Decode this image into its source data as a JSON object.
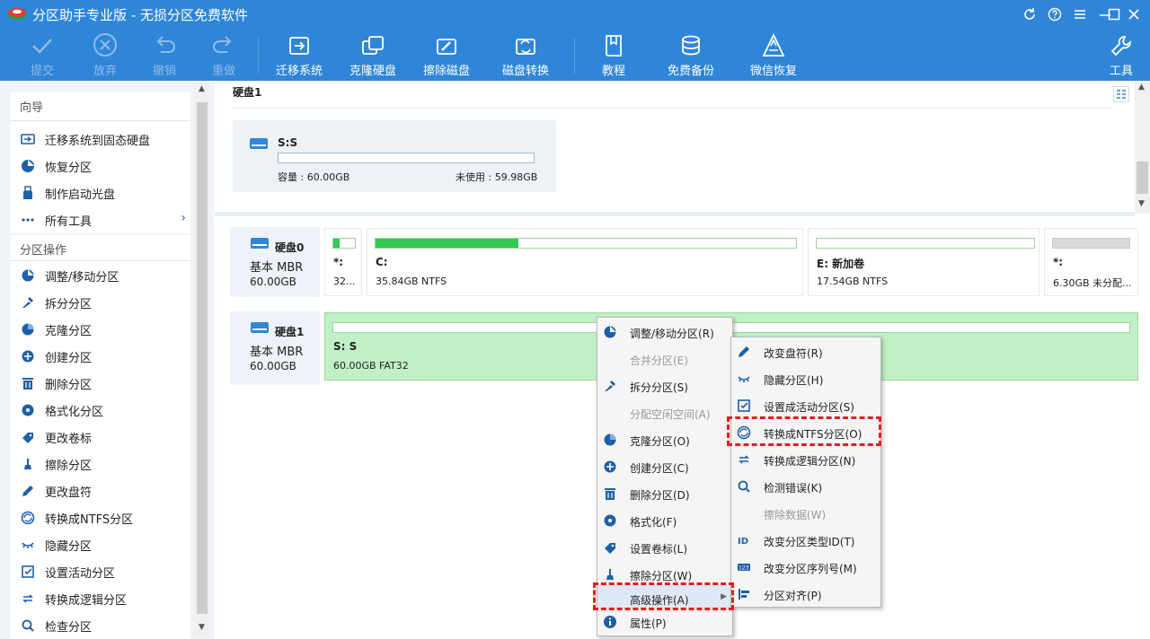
{
  "window": {
    "title": "分区助手专业版 - 无损分区免费软件"
  },
  "toolbar": {
    "commit": "提交",
    "discard": "放弃",
    "undo": "撤销",
    "redo": "重做",
    "migrate": "迁移系统",
    "clone": "克隆硬盘",
    "wipe": "擦除磁盘",
    "convert": "磁盘转换",
    "tutorial": "教程",
    "backup": "免费备份",
    "wechat": "微信恢复",
    "tools": "工具"
  },
  "sidebar": {
    "wizard_title": "向导",
    "wizard_items": [
      "迁移系统到固态硬盘",
      "恢复分区",
      "制作启动光盘",
      "所有工具"
    ],
    "ops_title": "分区操作",
    "ops_items": [
      "调整/移动分区",
      "拆分分区",
      "克隆分区",
      "创建分区",
      "删除分区",
      "格式化分区",
      "更改卷标",
      "擦除分区",
      "更改盘符",
      "转换成NTFS分区",
      "隐藏分区",
      "设置活动分区",
      "转换成逻辑分区",
      "检查分区"
    ]
  },
  "upper": {
    "disk_title": "硬盘1",
    "card": {
      "name": "S:S",
      "capacity": "容量 : 60.00GB",
      "unused": "未使用 : 59.98GB"
    }
  },
  "disks": [
    {
      "name": "硬盘0",
      "type": "基本 MBR",
      "size": "60.00GB",
      "partitions": [
        {
          "name": "*:",
          "info": "32...",
          "used": 0.3
        },
        {
          "name": "C:",
          "info": "35.84GB NTFS",
          "used": 0.34
        },
        {
          "name": "E: 新加卷",
          "info": "17.54GB NTFS",
          "used": 0.0
        },
        {
          "name": "*:",
          "info": "6.30GB 未分配...",
          "used": 0.0
        }
      ]
    },
    {
      "name": "硬盘1",
      "type": "基本 MBR",
      "size": "60.00GB",
      "partitions": [
        {
          "name": "S: S",
          "info": "60.00GB FAT32",
          "used": 0.0
        }
      ]
    }
  ],
  "context_menu": [
    {
      "label": "调整/移动分区(R)",
      "icon": "resize-icon",
      "enabled": true
    },
    {
      "label": "合并分区(E)",
      "icon": "",
      "enabled": false
    },
    {
      "label": "拆分分区(S)",
      "icon": "split-icon",
      "enabled": true
    },
    {
      "label": "分配空闲空间(A)",
      "icon": "",
      "enabled": false
    },
    {
      "label": "克隆分区(O)",
      "icon": "clone-icon",
      "enabled": true
    },
    {
      "label": "创建分区(C)",
      "icon": "create-icon",
      "enabled": true
    },
    {
      "label": "删除分区(D)",
      "icon": "trash-icon",
      "enabled": true
    },
    {
      "label": "格式化(F)",
      "icon": "format-icon",
      "enabled": true
    },
    {
      "label": "设置卷标(L)",
      "icon": "tag-icon",
      "enabled": true
    },
    {
      "label": "擦除分区(W)",
      "icon": "wipe-icon",
      "enabled": true
    },
    {
      "label": "高级操作(A)",
      "icon": "",
      "enabled": true
    },
    {
      "label": "属性(P)",
      "icon": "info-icon",
      "enabled": true
    }
  ],
  "submenu": [
    {
      "label": "改变盘符(R)",
      "icon": "pen-icon",
      "enabled": true
    },
    {
      "label": "隐藏分区(H)",
      "icon": "hide-icon",
      "enabled": true
    },
    {
      "label": "设置成活动分区(S)",
      "icon": "active-icon",
      "enabled": true
    },
    {
      "label": "转换成NTFS分区(O)",
      "icon": "convert-icon",
      "enabled": true
    },
    {
      "label": "转换成逻辑分区(N)",
      "icon": "logical-icon",
      "enabled": true
    },
    {
      "label": "检测错误(K)",
      "icon": "check-icon",
      "enabled": true
    },
    {
      "label": "擦除数据(W)",
      "icon": "",
      "enabled": false
    },
    {
      "label": "改变分区类型ID(T)",
      "icon": "id-icon",
      "enabled": true
    },
    {
      "label": "改变分区序列号(M)",
      "icon": "serial-icon",
      "enabled": true
    },
    {
      "label": "分区对齐(P)",
      "icon": "align-icon",
      "enabled": true
    }
  ],
  "colors": {
    "title_bar": "#2f86d9",
    "used_bar": "#35c951",
    "selected_partition": "#c2f0c6",
    "highlight": "#e0211f"
  }
}
